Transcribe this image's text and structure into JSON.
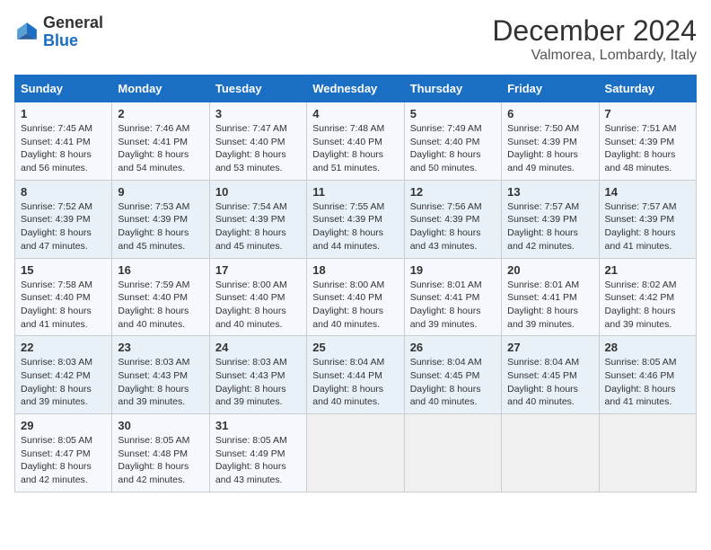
{
  "logo": {
    "line1": "General",
    "line2": "Blue"
  },
  "title": "December 2024",
  "location": "Valmorea, Lombardy, Italy",
  "days_header": [
    "Sunday",
    "Monday",
    "Tuesday",
    "Wednesday",
    "Thursday",
    "Friday",
    "Saturday"
  ],
  "weeks": [
    [
      {
        "day": "1",
        "sunrise": "7:45 AM",
        "sunset": "4:41 PM",
        "daylight": "8 hours and 56 minutes."
      },
      {
        "day": "2",
        "sunrise": "7:46 AM",
        "sunset": "4:41 PM",
        "daylight": "8 hours and 54 minutes."
      },
      {
        "day": "3",
        "sunrise": "7:47 AM",
        "sunset": "4:40 PM",
        "daylight": "8 hours and 53 minutes."
      },
      {
        "day": "4",
        "sunrise": "7:48 AM",
        "sunset": "4:40 PM",
        "daylight": "8 hours and 51 minutes."
      },
      {
        "day": "5",
        "sunrise": "7:49 AM",
        "sunset": "4:40 PM",
        "daylight": "8 hours and 50 minutes."
      },
      {
        "day": "6",
        "sunrise": "7:50 AM",
        "sunset": "4:39 PM",
        "daylight": "8 hours and 49 minutes."
      },
      {
        "day": "7",
        "sunrise": "7:51 AM",
        "sunset": "4:39 PM",
        "daylight": "8 hours and 48 minutes."
      }
    ],
    [
      {
        "day": "8",
        "sunrise": "7:52 AM",
        "sunset": "4:39 PM",
        "daylight": "8 hours and 47 minutes."
      },
      {
        "day": "9",
        "sunrise": "7:53 AM",
        "sunset": "4:39 PM",
        "daylight": "8 hours and 45 minutes."
      },
      {
        "day": "10",
        "sunrise": "7:54 AM",
        "sunset": "4:39 PM",
        "daylight": "8 hours and 45 minutes."
      },
      {
        "day": "11",
        "sunrise": "7:55 AM",
        "sunset": "4:39 PM",
        "daylight": "8 hours and 44 minutes."
      },
      {
        "day": "12",
        "sunrise": "7:56 AM",
        "sunset": "4:39 PM",
        "daylight": "8 hours and 43 minutes."
      },
      {
        "day": "13",
        "sunrise": "7:57 AM",
        "sunset": "4:39 PM",
        "daylight": "8 hours and 42 minutes."
      },
      {
        "day": "14",
        "sunrise": "7:57 AM",
        "sunset": "4:39 PM",
        "daylight": "8 hours and 41 minutes."
      }
    ],
    [
      {
        "day": "15",
        "sunrise": "7:58 AM",
        "sunset": "4:40 PM",
        "daylight": "8 hours and 41 minutes."
      },
      {
        "day": "16",
        "sunrise": "7:59 AM",
        "sunset": "4:40 PM",
        "daylight": "8 hours and 40 minutes."
      },
      {
        "day": "17",
        "sunrise": "8:00 AM",
        "sunset": "4:40 PM",
        "daylight": "8 hours and 40 minutes."
      },
      {
        "day": "18",
        "sunrise": "8:00 AM",
        "sunset": "4:40 PM",
        "daylight": "8 hours and 40 minutes."
      },
      {
        "day": "19",
        "sunrise": "8:01 AM",
        "sunset": "4:41 PM",
        "daylight": "8 hours and 39 minutes."
      },
      {
        "day": "20",
        "sunrise": "8:01 AM",
        "sunset": "4:41 PM",
        "daylight": "8 hours and 39 minutes."
      },
      {
        "day": "21",
        "sunrise": "8:02 AM",
        "sunset": "4:42 PM",
        "daylight": "8 hours and 39 minutes."
      }
    ],
    [
      {
        "day": "22",
        "sunrise": "8:03 AM",
        "sunset": "4:42 PM",
        "daylight": "8 hours and 39 minutes."
      },
      {
        "day": "23",
        "sunrise": "8:03 AM",
        "sunset": "4:43 PM",
        "daylight": "8 hours and 39 minutes."
      },
      {
        "day": "24",
        "sunrise": "8:03 AM",
        "sunset": "4:43 PM",
        "daylight": "8 hours and 39 minutes."
      },
      {
        "day": "25",
        "sunrise": "8:04 AM",
        "sunset": "4:44 PM",
        "daylight": "8 hours and 40 minutes."
      },
      {
        "day": "26",
        "sunrise": "8:04 AM",
        "sunset": "4:45 PM",
        "daylight": "8 hours and 40 minutes."
      },
      {
        "day": "27",
        "sunrise": "8:04 AM",
        "sunset": "4:45 PM",
        "daylight": "8 hours and 40 minutes."
      },
      {
        "day": "28",
        "sunrise": "8:05 AM",
        "sunset": "4:46 PM",
        "daylight": "8 hours and 41 minutes."
      }
    ],
    [
      {
        "day": "29",
        "sunrise": "8:05 AM",
        "sunset": "4:47 PM",
        "daylight": "8 hours and 42 minutes."
      },
      {
        "day": "30",
        "sunrise": "8:05 AM",
        "sunset": "4:48 PM",
        "daylight": "8 hours and 42 minutes."
      },
      {
        "day": "31",
        "sunrise": "8:05 AM",
        "sunset": "4:49 PM",
        "daylight": "8 hours and 43 minutes."
      },
      null,
      null,
      null,
      null
    ]
  ]
}
